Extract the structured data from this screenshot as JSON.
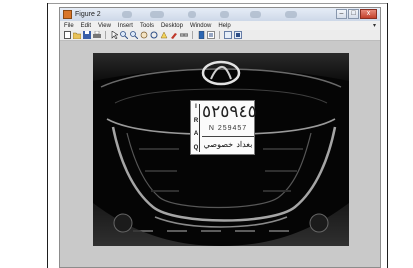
{
  "window": {
    "title": "Figure 2",
    "controls": {
      "minimize": "–",
      "maximize": "□",
      "close": "x"
    }
  },
  "menubar": {
    "items": [
      "File",
      "Edit",
      "View",
      "Insert",
      "Tools",
      "Desktop",
      "Window",
      "Help"
    ],
    "overflow_arrow": "▾"
  },
  "toolbar": {
    "icons": [
      "new-figure-icon",
      "open-file-icon",
      "save-icon",
      "print-icon",
      "pointer-icon",
      "zoom-in-icon",
      "zoom-out-icon",
      "pan-icon",
      "rotate-3d-icon",
      "data-cursor-icon",
      "brush-icon",
      "link-icon",
      "insert-colorbar-icon",
      "insert-legend-icon",
      "hide-plot-tools-icon",
      "show-plot-tools-icon"
    ]
  },
  "plate": {
    "main_number": "٥٢٥٩٤٥",
    "side_text": [
      "I",
      "R",
      "A",
      "Q"
    ],
    "latin_number": "N 259457",
    "city": "بغداد",
    "type": "خصوصي"
  }
}
